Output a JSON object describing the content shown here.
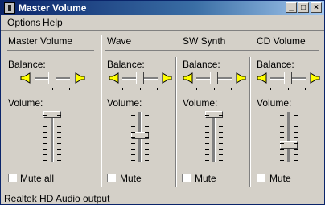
{
  "window": {
    "title": "Master Volume",
    "icon": "volume-control-icon",
    "controls": {
      "minimize": "_",
      "maximize": "□",
      "close": "×"
    }
  },
  "menu": [
    "Options",
    "Help"
  ],
  "labels": {
    "balance": "Balance:",
    "volume": "Volume:"
  },
  "channels": [
    {
      "name": "Master Volume",
      "mute_label": "Mute all",
      "muted": false,
      "balance": 0.5,
      "volume": 0.95
    },
    {
      "name": "Wave",
      "mute_label": "Mute",
      "muted": false,
      "balance": 0.5,
      "volume": 0.5
    },
    {
      "name": "SW Synth",
      "mute_label": "Mute",
      "muted": false,
      "balance": 0.5,
      "volume": 0.95
    },
    {
      "name": "CD Volume",
      "mute_label": "Mute",
      "muted": false,
      "balance": 0.5,
      "volume": 0.3
    }
  ],
  "status": "Realtek HD Audio output",
  "colors": {
    "face": "#d4d0c8",
    "title_start": "#0a246a",
    "title_end": "#a6caf0",
    "speaker": "#ffff00"
  }
}
